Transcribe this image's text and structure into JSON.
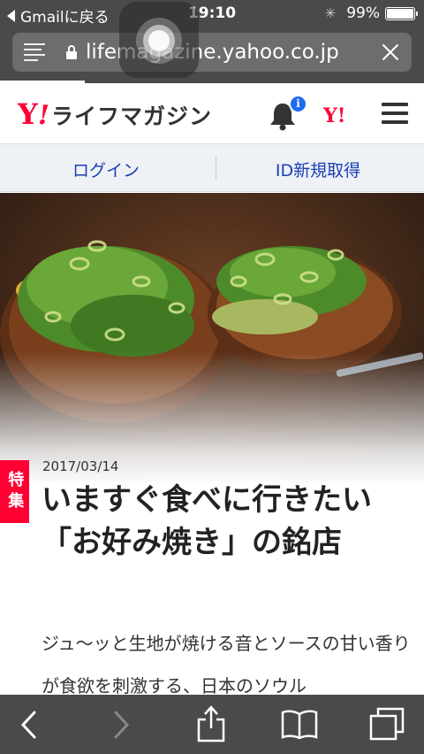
{
  "status_bar": {
    "back_app": "Gmailに戻る",
    "time": "19:10",
    "battery": "99%",
    "battery_level": 0.99
  },
  "browser": {
    "url": "lifemagazine.yahoo.co.jp",
    "icons": [
      "reader-icon",
      "lock-icon",
      "close-icon"
    ],
    "load_progress": 0.2
  },
  "header": {
    "logo_mark": "Y",
    "logo_exclaim": "!",
    "logo_text": "ライフマガジン",
    "notification_count": "i",
    "yahoo_link": "Y!",
    "icons": [
      "bell-icon",
      "menu-icon"
    ],
    "colors": {
      "brand": "#ff0033",
      "badge": "#1e6cf0"
    }
  },
  "auth": {
    "login_label": "ログイン",
    "signup_label": "ID新規取得"
  },
  "article": {
    "badge": "特集",
    "date": "2017/03/14",
    "title": "いますぐ食べに行きたい「お好み焼き」の銘店",
    "lead": "ジュ〜ッと生地が焼ける音とソースの甘い香りが食欲を刺激する、日本のソウル"
  },
  "toolbar": {
    "icons": [
      "back-arrow-icon",
      "forward-arrow-icon",
      "share-icon",
      "bookmarks-icon",
      "tabs-icon"
    ]
  }
}
